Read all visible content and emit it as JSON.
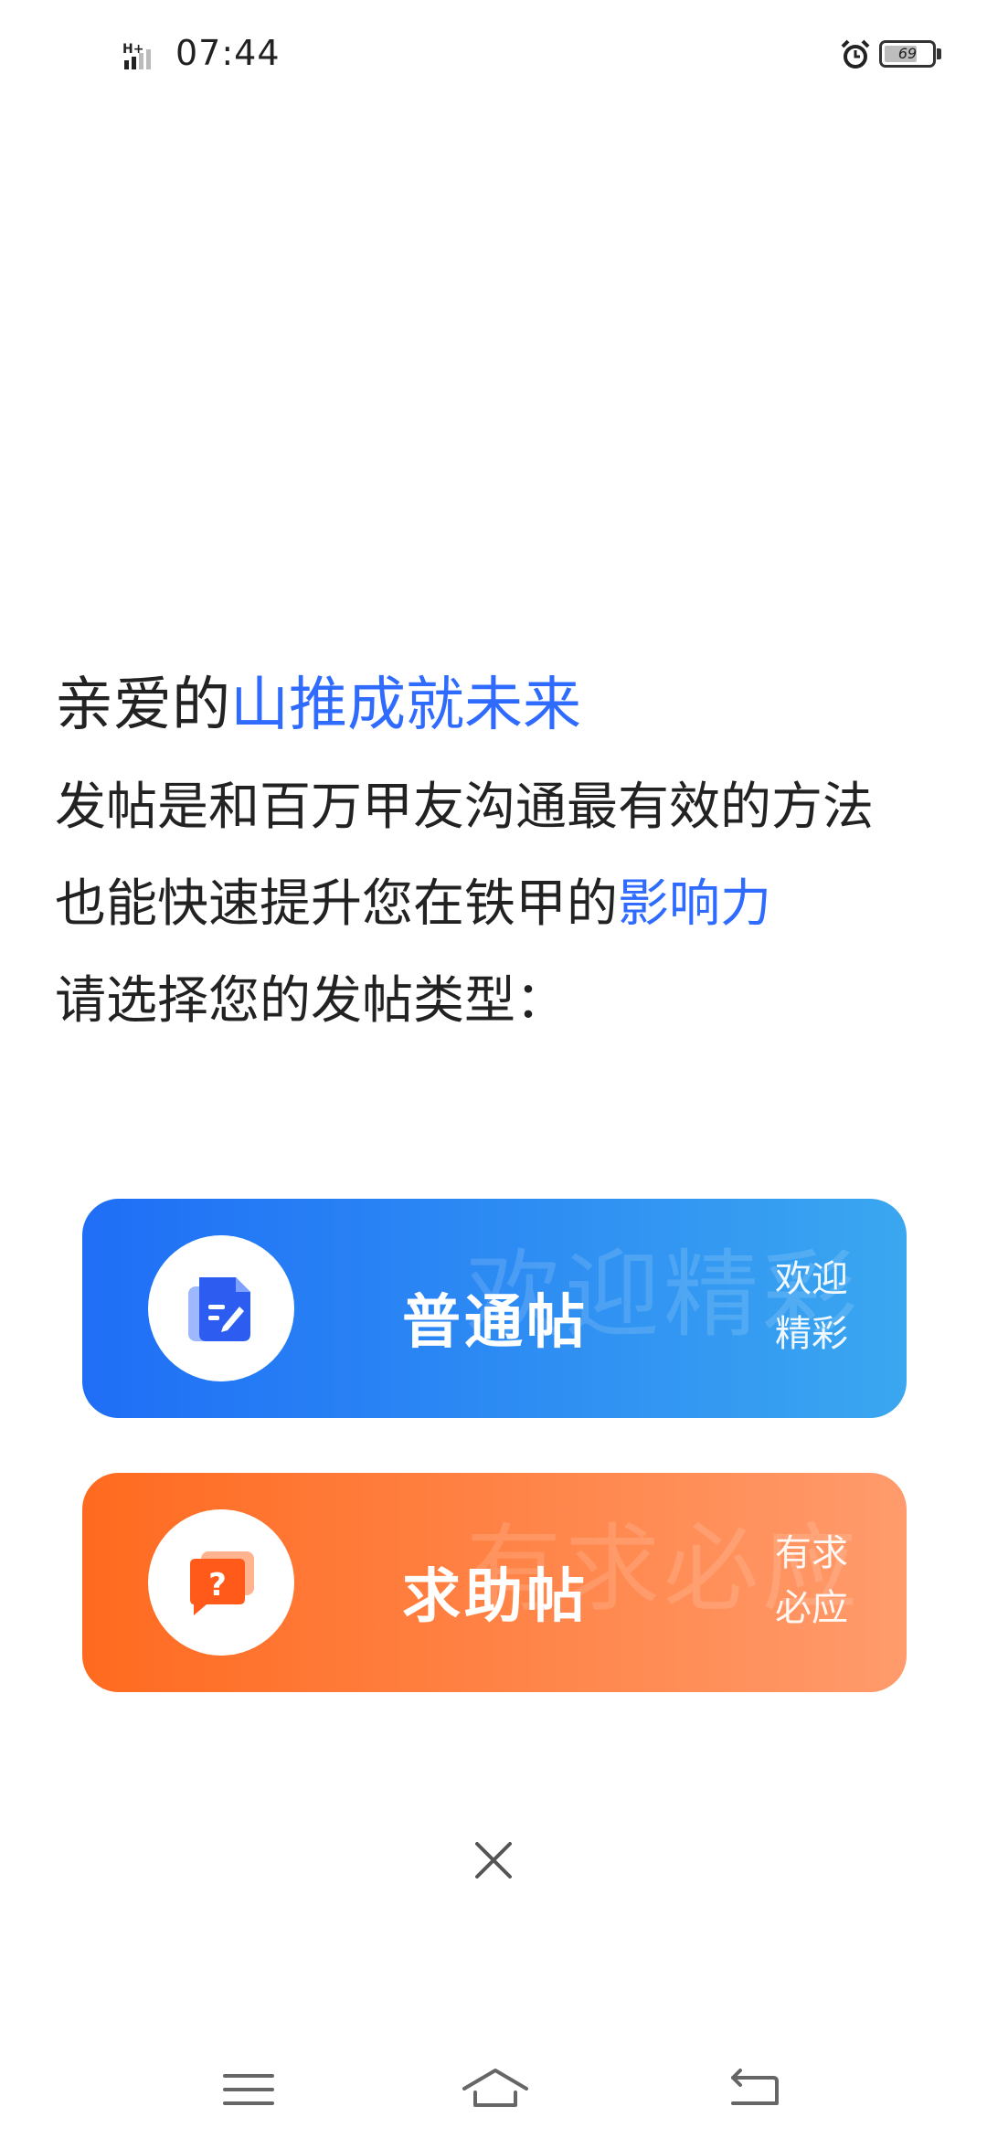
{
  "status_bar": {
    "network": "H+",
    "time": "07:44",
    "battery_level": "69",
    "battery_fraction": 0.69,
    "icons": [
      "signal-icon",
      "alarm-icon",
      "battery-icon"
    ]
  },
  "intro": {
    "greeting_prefix": "亲爱的",
    "username": "山推成就未来",
    "line2": "发帖是和百万甲友沟通最有效的方法",
    "line3_prefix": "也能快速提升您在铁甲的",
    "line3_highlight": "影响力",
    "line4": "请选择您的发帖类型："
  },
  "post_types": [
    {
      "title": "普通帖",
      "watermark": "欢迎精彩",
      "tag_line1": "欢迎",
      "tag_line2": "精彩",
      "icon": "document-edit-icon"
    },
    {
      "title": "求助帖",
      "watermark": "有求必应",
      "tag_line1": "有求",
      "tag_line2": "必应",
      "icon": "question-chat-icon"
    }
  ],
  "close": {
    "icon": "close-icon"
  },
  "nav": {
    "icons": [
      "menu-icon",
      "home-icon",
      "back-icon"
    ]
  },
  "colors": {
    "accent": "#2f6bff",
    "normal_gradient_start": "#1f6ef6",
    "normal_gradient_end": "#3aa7f0",
    "help_gradient_start": "#ff6a1f",
    "help_gradient_end": "#ff9b6c"
  }
}
